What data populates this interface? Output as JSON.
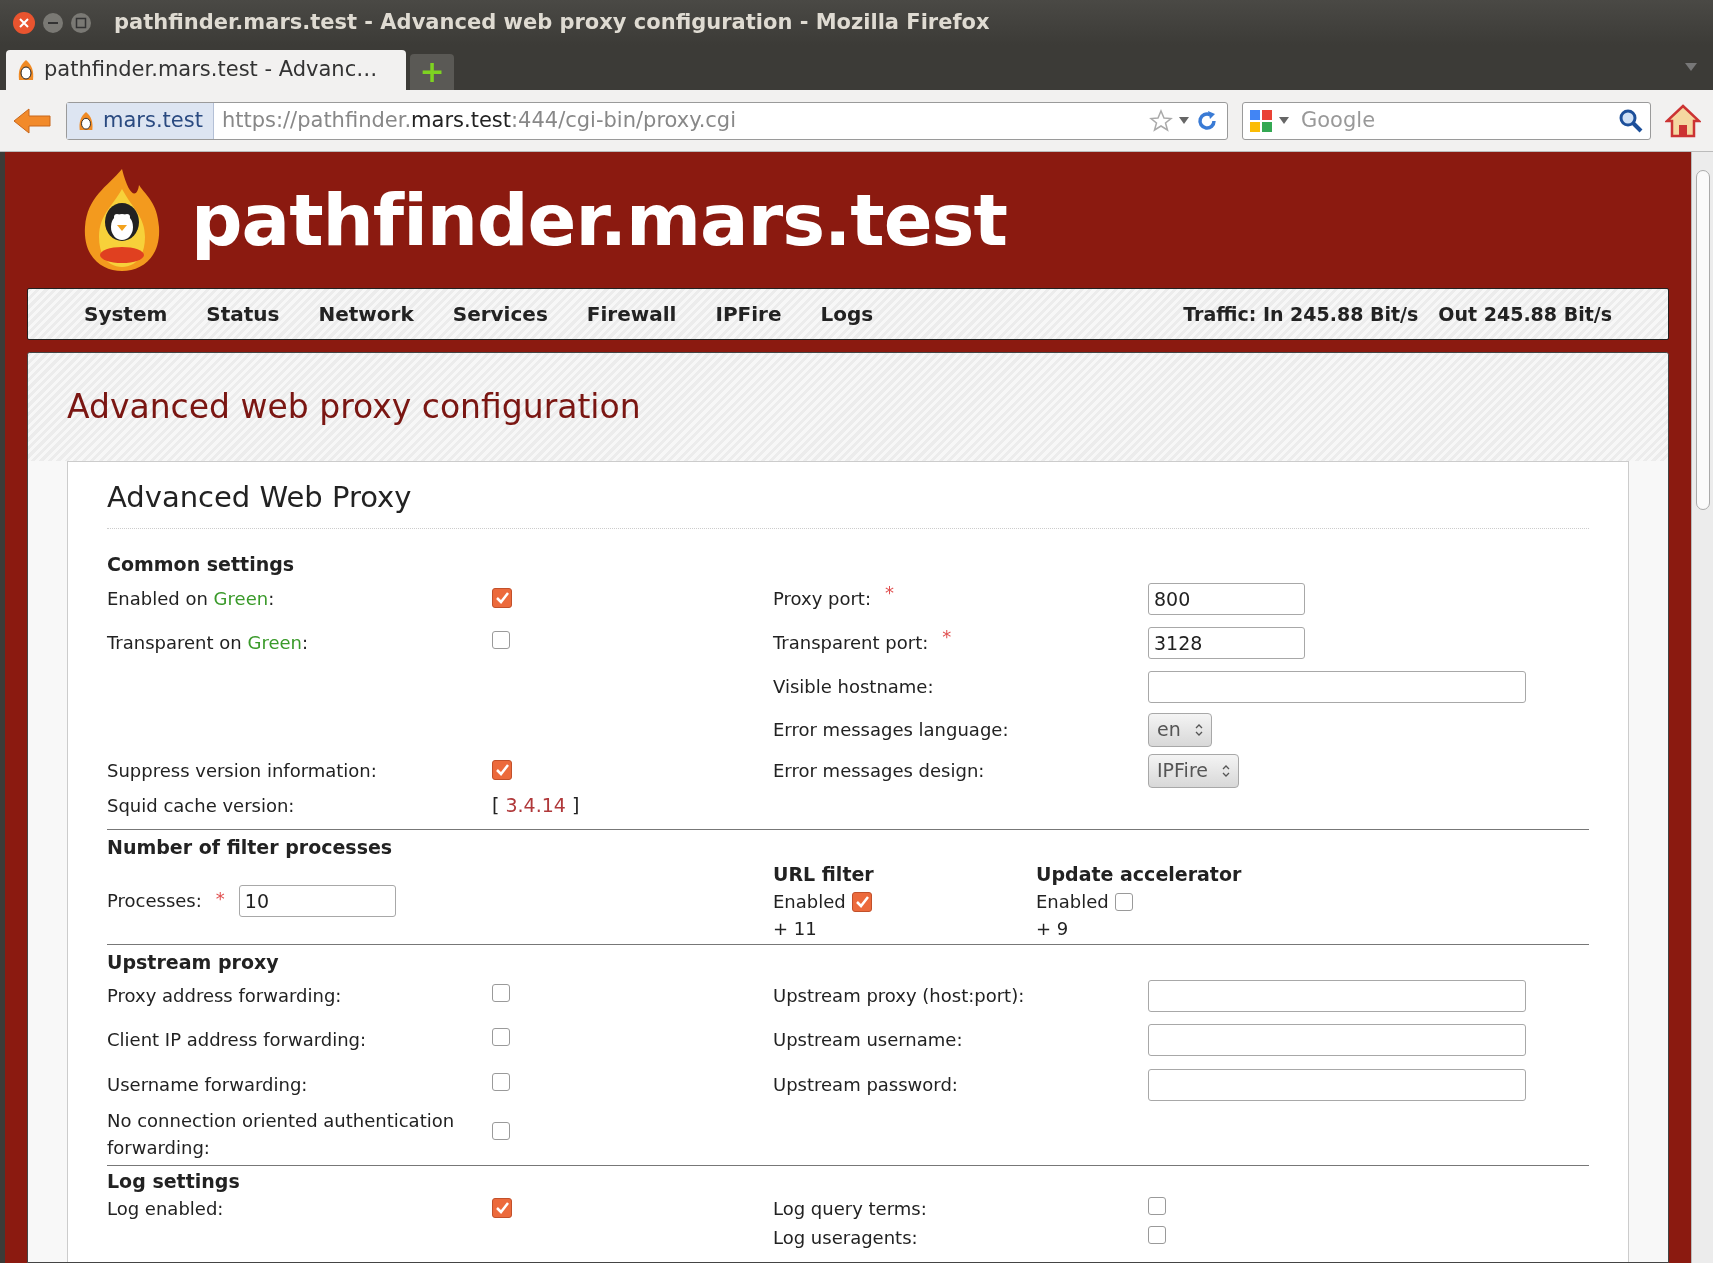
{
  "window": {
    "title": "pathfinder.mars.test - Advanced web proxy configuration - Mozilla Firefox"
  },
  "tab": {
    "title": "pathfinder.mars.test - Advanc…",
    "new_tab": "+"
  },
  "address_bar": {
    "identity": "mars.test",
    "url_parts": [
      {
        "text": "https://pathfinder.",
        "strong": false
      },
      {
        "text": "mars.test",
        "strong": true
      },
      {
        "text": ":444/cgi-bin/proxy.cgi",
        "strong": false
      }
    ]
  },
  "search": {
    "placeholder": "Google"
  },
  "site": {
    "title": "pathfinder.mars.test"
  },
  "nav": {
    "items": [
      "System",
      "Status",
      "Network",
      "Services",
      "Firewall",
      "IPFire",
      "Logs"
    ],
    "traffic_in": "Traffic: In 245.88 Bit/s",
    "traffic_out": "Out 245.88 Bit/s"
  },
  "page": {
    "title": "Advanced web proxy configuration",
    "box_title": "Advanced Web Proxy"
  },
  "common": {
    "heading": "Common settings",
    "rows": [
      {
        "left": {
          "label": [
            {
              "text": "Enabled on "
            },
            {
              "text": "Green",
              "color": "#3a9a2a"
            },
            {
              "text": ":"
            }
          ],
          "kind": "checkbox",
          "checked": true
        },
        "right": {
          "label": "Proxy port:",
          "required": "*",
          "kind": "port",
          "value": "800"
        }
      },
      {
        "left": {
          "label": [
            {
              "text": "Transparent on "
            },
            {
              "text": "Green",
              "color": "#3a9a2a"
            },
            {
              "text": ":"
            }
          ],
          "kind": "checkbox",
          "checked": false
        },
        "right": {
          "label": "Transparent port:",
          "required": "*",
          "kind": "port",
          "value": "3128"
        }
      },
      {
        "right": {
          "label": "Visible hostname:",
          "kind": "text"
        }
      },
      {
        "right": {
          "label": "Error messages language:",
          "kind": "select",
          "value": "en"
        }
      },
      {
        "left": {
          "label": "Suppress version information:",
          "kind": "checkbox",
          "checked": true
        },
        "right": {
          "label": "Error messages design:",
          "kind": "select",
          "value": "IPFire"
        }
      },
      {
        "left": {
          "label": "Squid cache version:",
          "kind": "version",
          "open": "[",
          "value": "3.4.14",
          "close": "]"
        }
      }
    ]
  },
  "filters": {
    "heading": "Number of filter processes",
    "processes_label": "Processes:",
    "required": "*",
    "processes_value": "10",
    "modules": [
      {
        "title": "URL filter",
        "enabled_label": "Enabled",
        "checked": true,
        "count": "+ 11"
      },
      {
        "title": "Update accelerator",
        "enabled_label": "Enabled",
        "checked": false,
        "count": "+ 9"
      }
    ]
  },
  "upstream": {
    "heading": "Upstream proxy",
    "rows": [
      {
        "left": {
          "label": "Proxy address forwarding:",
          "kind": "checkbox",
          "checked": false
        },
        "right": {
          "label": "Upstream proxy (host:port):",
          "kind": "text"
        }
      },
      {
        "left": {
          "label": "Client IP address forwarding:",
          "kind": "checkbox",
          "checked": false
        },
        "right": {
          "label": "Upstream username:",
          "kind": "text"
        }
      },
      {
        "left": {
          "label": "Username forwarding:",
          "kind": "checkbox",
          "checked": false
        },
        "right": {
          "label": "Upstream password:",
          "kind": "text"
        }
      },
      {
        "left": {
          "label": "No connection oriented authentication forwarding:",
          "kind": "checkbox",
          "checked": false
        }
      }
    ]
  },
  "log": {
    "heading": "Log settings",
    "rows": [
      {
        "left": {
          "label": "Log enabled:",
          "kind": "checkbox",
          "checked": true
        },
        "right": {
          "label": "Log query terms:",
          "kind": "checkbox",
          "checked": false
        }
      },
      {
        "right": {
          "label": "Log useragents:",
          "kind": "checkbox",
          "checked": false
        }
      }
    ]
  }
}
